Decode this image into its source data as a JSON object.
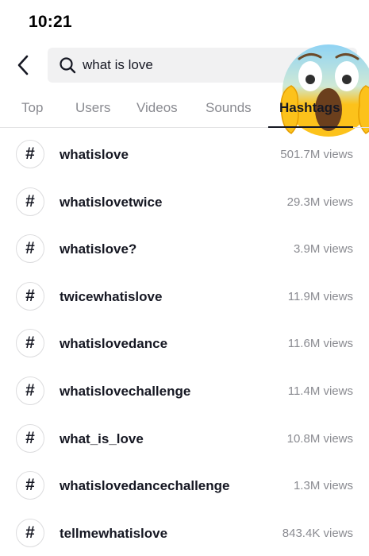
{
  "status_bar": {
    "time": "10:21"
  },
  "search": {
    "query": "what is love",
    "back_icon": "chevron-left-icon",
    "search_icon": "magnifier-icon"
  },
  "overlay": {
    "emoji": "face-screaming-in-fear-emoji"
  },
  "tabs": [
    {
      "label": "Top",
      "active": false
    },
    {
      "label": "Users",
      "active": false
    },
    {
      "label": "Videos",
      "active": false
    },
    {
      "label": "Sounds",
      "active": false
    },
    {
      "label": "Hashtags",
      "active": true
    }
  ],
  "hashtags": [
    {
      "icon": "#",
      "name": "whatislove",
      "views": "501.7M views"
    },
    {
      "icon": "#",
      "name": "whatislovetwice",
      "views": "29.3M views"
    },
    {
      "icon": "#",
      "name": "whatislove?",
      "views": "3.9M views"
    },
    {
      "icon": "#",
      "name": "twicewhatislove",
      "views": "11.9M views"
    },
    {
      "icon": "#",
      "name": "whatislovedance",
      "views": "11.6M views"
    },
    {
      "icon": "#",
      "name": "whatislovechallenge",
      "views": "11.4M views"
    },
    {
      "icon": "#",
      "name": "what_is_love",
      "views": "10.8M views"
    },
    {
      "icon": "#",
      "name": "whatislovedancechallenge",
      "views": "1.3M views"
    },
    {
      "icon": "#",
      "name": "tellmewhatislove",
      "views": "843.4K views"
    }
  ],
  "colors": {
    "text_primary": "#161823",
    "text_secondary": "#8a8b91",
    "search_bg": "#f1f1f2",
    "emoji_yellow": "#fcc21b",
    "emoji_blue": "#8fd3f4"
  }
}
